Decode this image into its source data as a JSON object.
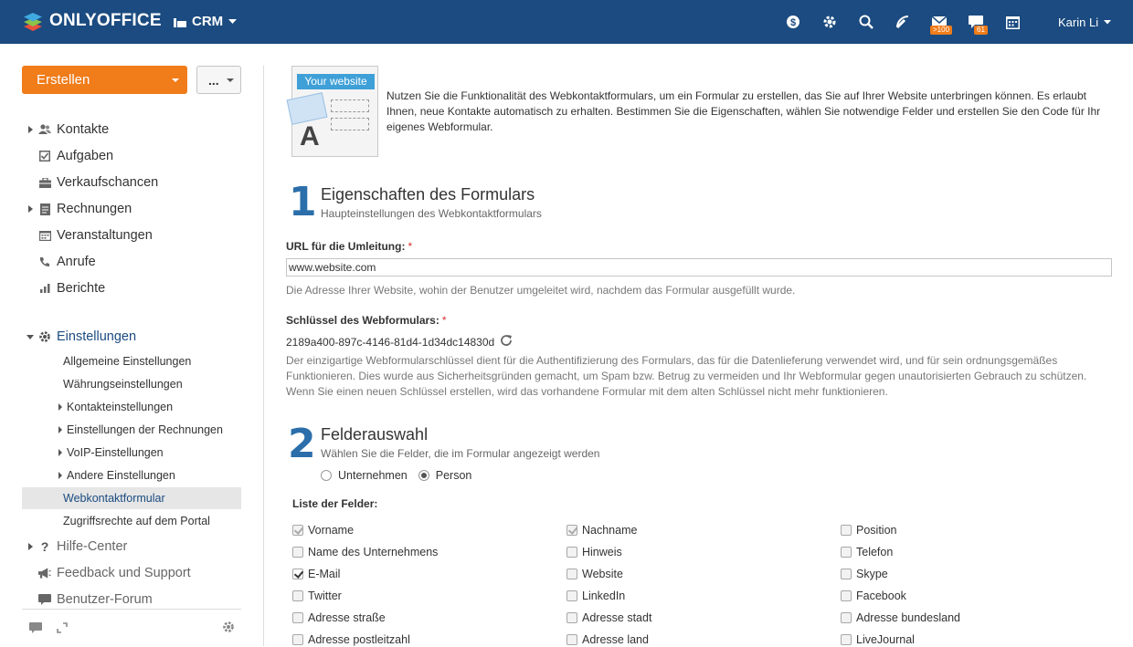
{
  "header": {
    "logo_text": "ONLYOFFICE",
    "module": "CRM",
    "user": "Karin Li",
    "mail_badge": ">100",
    "chat_badge": "61",
    "brand_color": "#1b4b80",
    "accent_color": "#f07c1a"
  },
  "sidebar": {
    "create_label": "Erstellen",
    "more_label": "...",
    "items": [
      {
        "label": "Kontakte",
        "icon": "users-icon"
      },
      {
        "label": "Aufgaben",
        "icon": "tasks-icon"
      },
      {
        "label": "Verkaufschancen",
        "icon": "briefcase-icon"
      },
      {
        "label": "Rechnungen",
        "icon": "invoice-icon"
      },
      {
        "label": "Veranstaltungen",
        "icon": "calendar-icon"
      },
      {
        "label": "Anrufe",
        "icon": "phone-icon"
      },
      {
        "label": "Berichte",
        "icon": "chart-icon"
      }
    ],
    "settings": {
      "label": "Einstellungen",
      "subitems": [
        "Allgemeine Einstellungen",
        "Währungseinstellungen",
        "Kontakteinstellungen",
        "Einstellungen der Rechnungen",
        "VoIP-Einstellungen",
        "Andere Einstellungen",
        "Webkontaktformular",
        "Zugriffsrechte auf dem Portal"
      ]
    },
    "help_center": "Hilfe-Center",
    "feedback": "Feedback und Support",
    "forum": "Benutzer-Forum"
  },
  "main": {
    "illustration_label": "Your website",
    "illustration_letter": "A",
    "intro": "Nutzen Sie die Funktionalität des Webkontaktformulars, um ein Formular zu erstellen, das Sie auf Ihrer Website unterbringen können. Es erlaubt Ihnen, neue Kontakte automatisch zu erhalten. Bestimmen Sie die Eigenschaften, wählen Sie notwendige Felder und erstellen Sie den Code für Ihr eigenes Webformular.",
    "step1": {
      "num": "1",
      "title": "Eigenschaften des Formulars",
      "subtitle": "Haupteinstellungen des Webkontaktformulars"
    },
    "url_label": "URL für die Umleitung:",
    "required_mark": "*",
    "url_value": "www.website.com",
    "url_help": "Die Adresse Ihrer Website, wohin der Benutzer umgeleitet wird, nachdem das Formular ausgefüllt wurde.",
    "key_label": "Schlüssel des Webformulars:",
    "key_value": "2189a400-897c-4146-81d4-1d34dc14830d",
    "key_help": "Der einzigartige Webformularschlüssel dient für die Authentifizierung des Formulars, das für die Datenlieferung verwendet wird, und für sein ordnungsgemäßes Funktionieren. Dies wurde aus Sicherheitsgründen gemacht, um Spam bzw. Betrug zu vermeiden und Ihr Webformular gegen unautorisierten Gebrauch zu schützen. Wenn Sie einen neuen Schlüssel erstellen, wird das vorhandene Formular mit dem alten Schlüssel nicht mehr funktionieren.",
    "step2": {
      "num": "2",
      "title": "Felderauswahl",
      "subtitle": "Wählen Sie die Felder, die im Formular angezeigt werden"
    },
    "radio_company": "Unternehmen",
    "radio_person": "Person",
    "fields_label": "Liste der Felder:",
    "fields": [
      [
        "Vorname",
        "Nachname",
        "Position"
      ],
      [
        "Name des Unternehmens",
        "Hinweis",
        "Telefon"
      ],
      [
        "E-Mail",
        "Website",
        "Skype"
      ],
      [
        "Twitter",
        "LinkedIn",
        "Facebook"
      ],
      [
        "Adresse straße",
        "Adresse stadt",
        "Adresse bundesland"
      ],
      [
        "Adresse postleitzahl",
        "Adresse land",
        "LiveJournal"
      ]
    ]
  }
}
